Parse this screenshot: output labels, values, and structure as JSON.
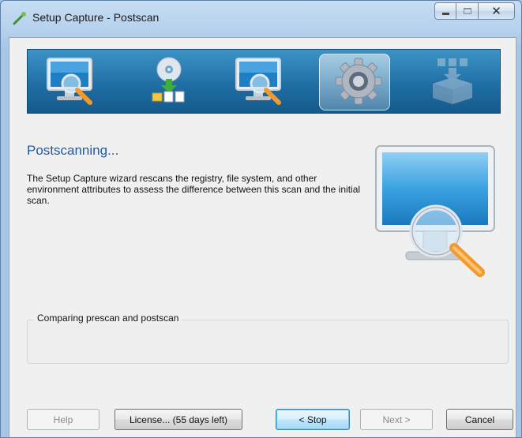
{
  "window": {
    "title": "Setup Capture - Postscan",
    "close_glyph": "✕"
  },
  "banner": {
    "steps": [
      {
        "icon": "monitor-magnifier-icon",
        "state": "normal"
      },
      {
        "icon": "disc-install-icon",
        "state": "normal"
      },
      {
        "icon": "monitor-magnifier-icon",
        "state": "normal"
      },
      {
        "icon": "gear-icon",
        "state": "active"
      },
      {
        "icon": "package-box-icon",
        "state": "disabled"
      }
    ]
  },
  "content": {
    "heading": "Postscanning...",
    "description": "The Setup Capture wizard rescans the registry, file system, and other environment attributes to assess the difference between this scan and the initial scan.",
    "status_group_label": "Comparing prescan and postscan"
  },
  "buttons": {
    "help": "Help",
    "license": "License... (55 days left)",
    "stop": "< Stop",
    "next": "Next >",
    "cancel": "Cancel"
  },
  "colors": {
    "heading": "#1e5aa8",
    "banner_top": "#3d93c6",
    "banner_bottom": "#155a8c",
    "accent_orange": "#f39a2b"
  }
}
